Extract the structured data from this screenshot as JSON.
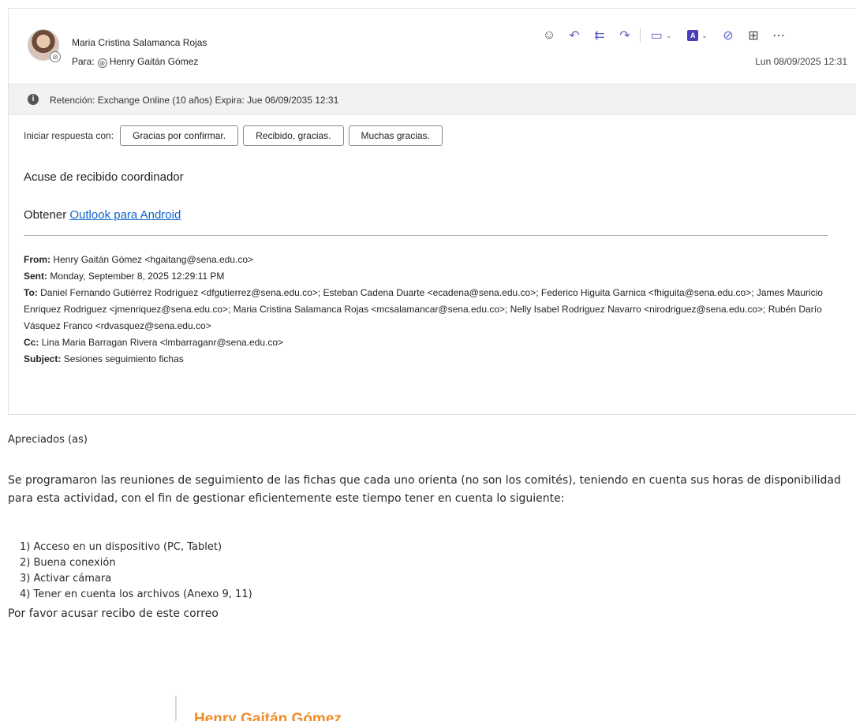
{
  "header": {
    "sender_name": "Maria Cristina Salamanca Rojas",
    "to_label": "Para:",
    "to_name": "Henry Gaitán Gómez",
    "date": "Lun 08/09/2025 12:31"
  },
  "toolbar": {
    "icons": [
      "emoji-icon",
      "reply-icon",
      "reply-all-icon",
      "forward-icon",
      "meeting-icon",
      "pdf-icon",
      "loop-icon",
      "apps-icon",
      "more-icon"
    ]
  },
  "retention": {
    "text": "Retención: Exchange Online (10 años) Expira: Jue 06/09/2035 12:31"
  },
  "quick_reply": {
    "label": "Iniciar respuesta con:",
    "options": [
      "Gracias por confirmar.",
      "Recibido, gracias.",
      "Muchas gracias."
    ]
  },
  "message": {
    "line1": "Acuse de recibido coordinador",
    "get_prefix": "Obtener",
    "get_link": "Outlook para Android"
  },
  "forwarded": {
    "from_label": "From:",
    "from": "Henry Gaitán Gómez <hgaitang@sena.edu.co>",
    "sent_label": "Sent:",
    "sent": "Monday, September 8, 2025 12:29:11 PM",
    "to_label": "To:",
    "to": "Daniel Fernando Gutiérrez Rodríguez <dfgutierrez@sena.edu.co>; Esteban Cadena Duarte <ecadena@sena.edu.co>; Federico Higuita Garnica <fhiguita@sena.edu.co>; James Mauricio Enriquez Rodriguez <jmenriquez@sena.edu.co>; Maria Cristina Salamanca Rojas <mcsalamancar@sena.edu.co>; Nelly Isabel Rodriguez Navarro <nirodriguez@sena.edu.co>; Rubén Darío Vásquez Franco <rdvasquez@sena.edu.co>",
    "cc_label": "Cc:",
    "cc": "Lina Maria Barragan Rivera <lmbarraganr@sena.edu.co>",
    "subject_label": "Subject:",
    "subject": "Sesiones seguimiento fichas"
  },
  "body": {
    "greeting": "Apreciados (as)",
    "paragraph": "Se programaron las reuniones de seguimiento  de las fichas que cada uno orienta (no son los comités), teniendo en cuenta sus horas de disponibilidad para esta actividad, con el fin de gestionar eficientemente este tiempo tener en cuenta lo siguiente:",
    "items": [
      "1) Acceso en un dispositivo (PC, Tablet)",
      "2) Buena conexión",
      "3) Activar cámara",
      "4) Tener en cuenta los archivos (Anexo 9, 11)"
    ],
    "closing": "Por favor acusar recibo de este correo",
    "signature_name": "Henry Gaitán Gómez"
  },
  "colors": {
    "accent": "#5b5fc7",
    "link": "#0f62c9",
    "signature": "#f08c26"
  }
}
